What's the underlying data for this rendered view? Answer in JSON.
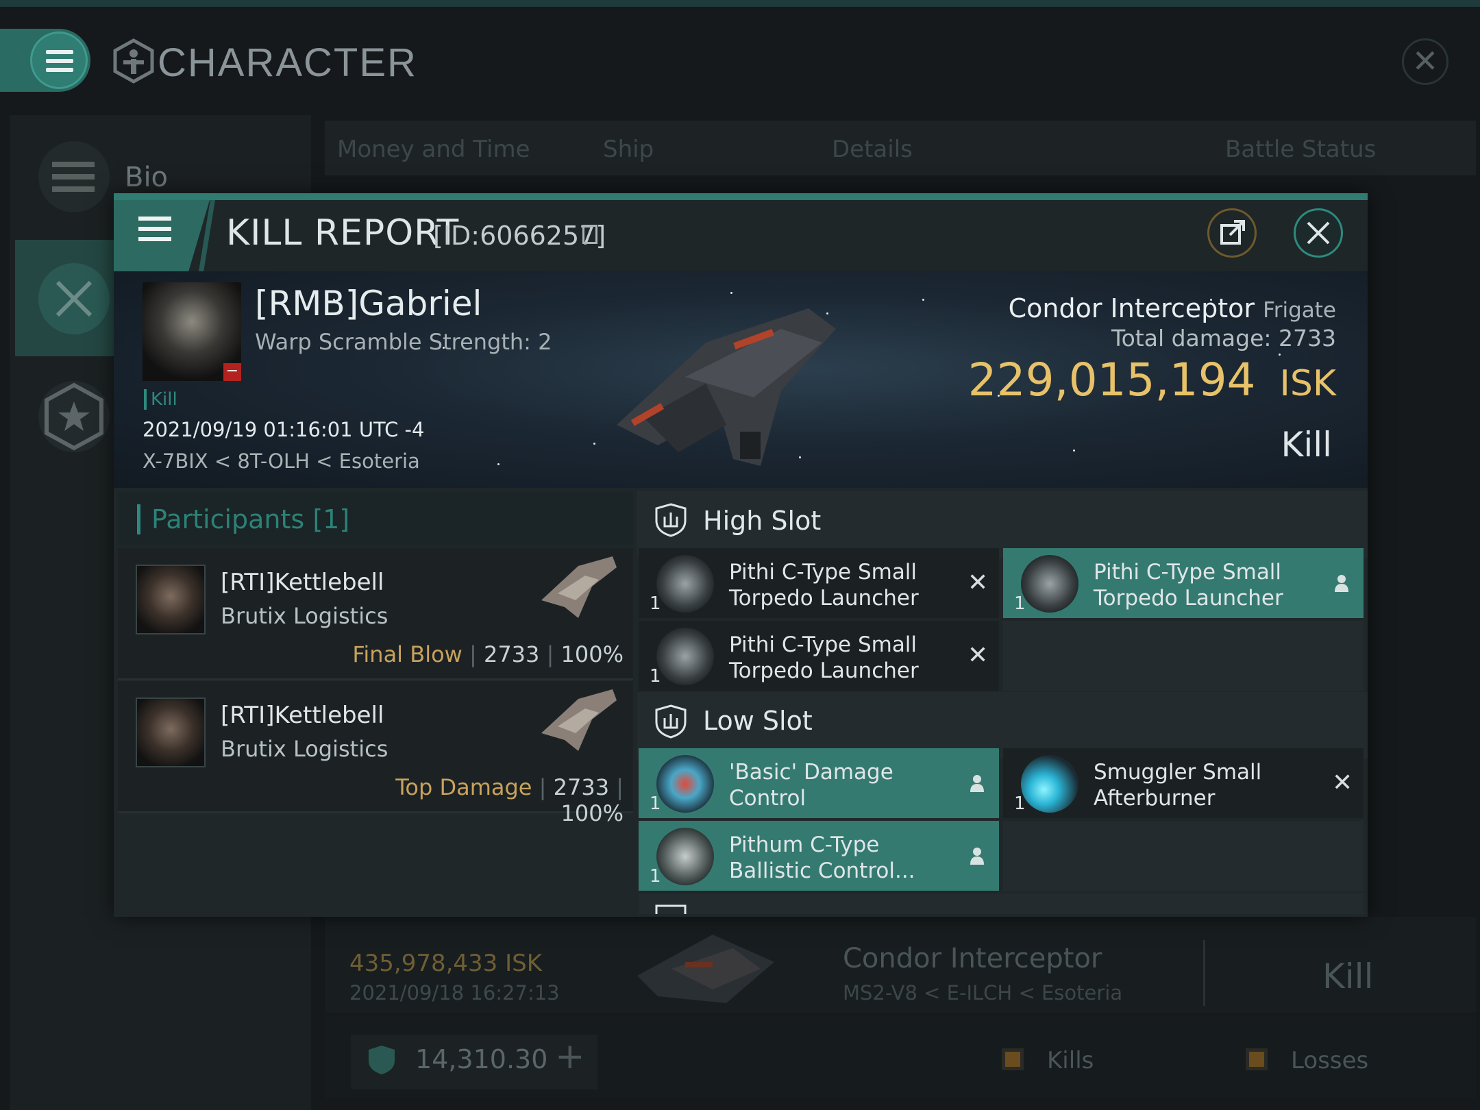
{
  "app": {
    "title": "CHARACTER"
  },
  "sidebar": {
    "bio_label": "Bio"
  },
  "bg_tabs": [
    "Money and Time",
    "Ship",
    "Details",
    "Battle Status"
  ],
  "kill_report": {
    "title": "KILL REPORT",
    "id": "[ID:6066257]",
    "victim": {
      "name": "[RMB]Gabriel",
      "warp_scramble": "Warp Scramble Strength: 2",
      "tag": "Kill",
      "time": "2021/09/19 01:16:01 UTC -4",
      "location": "X-7BIX < 8T-OLH < Esoteria"
    },
    "ship": {
      "name": "Condor Interceptor",
      "class": "Frigate",
      "total_damage_label": "Total damage:",
      "total_damage": "2733",
      "isk_value": "229,015,194",
      "isk_unit": "ISK",
      "result": "Kill"
    },
    "participants": {
      "title": "Participants",
      "count": "[1]",
      "rows": [
        {
          "name": "[RTI]Kettlebell",
          "corp": "Brutix Logistics",
          "role": "Final Blow",
          "damage": "2733",
          "percent": "100%"
        },
        {
          "name": "[RTI]Kettlebell",
          "corp": "Brutix Logistics",
          "role": "Top Damage",
          "damage": "2733",
          "percent": "100%"
        }
      ]
    },
    "slots": {
      "high": {
        "title": "High Slot",
        "modules": [
          {
            "name1": "Pithi C-Type Small",
            "name2": "Torpedo Launcher",
            "qty": "1",
            "state": "destroyed"
          },
          {
            "name1": "Pithi C-Type Small",
            "name2": "Torpedo Launcher",
            "qty": "1",
            "state": "dropped"
          },
          {
            "name1": "Pithi C-Type Small",
            "name2": "Torpedo Launcher",
            "qty": "1",
            "state": "destroyed"
          }
        ]
      },
      "low": {
        "title": "Low Slot",
        "modules": [
          {
            "name1": "'Basic' Damage",
            "name2": "Control",
            "qty": "1",
            "state": "dropped"
          },
          {
            "name1": "Smuggler Small",
            "name2": "Afterburner",
            "qty": "1",
            "state": "destroyed"
          },
          {
            "name1": "Pithum C-Type",
            "name2": "Ballistic Control...",
            "qty": "1",
            "state": "dropped"
          }
        ]
      }
    }
  },
  "background_list": {
    "isk": "435,978,433  ISK",
    "date": "2021/09/18  16:27:13",
    "ship": "Condor Interceptor",
    "location": "MS2-V8 < E-ILCH < Esoteria",
    "result": "Kill"
  },
  "footer": {
    "wallet": "14,310.30",
    "kills_label": "Kills",
    "losses_label": "Losses"
  },
  "colors": {
    "accent": "#2e8a7e",
    "isk_gold": "#e7c269",
    "dropped_bg": "#357a70",
    "destroyed_bg": "#1b2123"
  }
}
